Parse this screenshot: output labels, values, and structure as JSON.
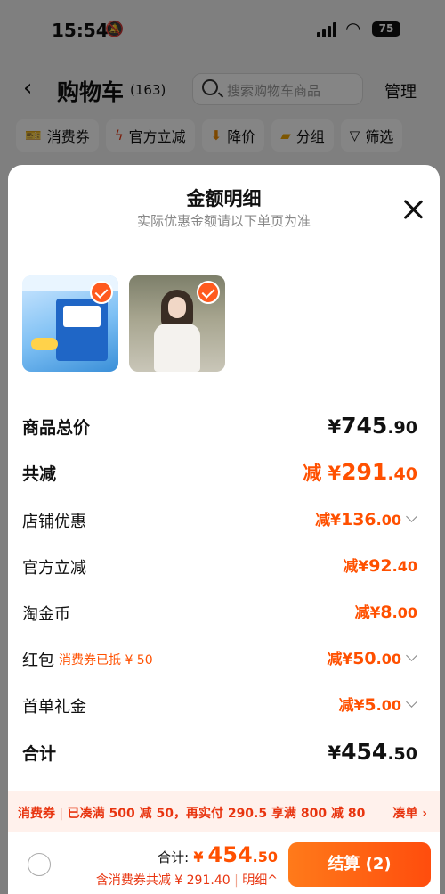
{
  "status_bar": {
    "time": "15:54",
    "battery": "75"
  },
  "cart": {
    "title": "购物车",
    "count": "(163)",
    "search_placeholder": "搜索购物车商品",
    "manage_label": "管理",
    "chips": [
      {
        "label": "消费券",
        "icon": "coupon-icon"
      },
      {
        "label": "官方立减",
        "icon": "lightning-icon"
      },
      {
        "label": "降价",
        "icon": "price-drop-icon"
      },
      {
        "label": "分组",
        "icon": "folder-icon"
      },
      {
        "label": "筛选",
        "icon": "filter-icon"
      }
    ]
  },
  "sheet": {
    "title": "金额明细",
    "subtitle": "实际优惠金额请以下单页为准",
    "rows": {
      "goods_total": {
        "label": "商品总价",
        "prefix": "¥",
        "int": "745",
        "dec": ".90"
      },
      "total_reduction": {
        "label": "共减",
        "prefix": "减 ¥",
        "int": "291",
        "dec": ".40"
      },
      "store_discount": {
        "label": "店铺优惠",
        "prefix": "减¥",
        "int": "136",
        "dec": ".00"
      },
      "official_discount": {
        "label": "官方立减",
        "prefix": "减¥",
        "int": "92",
        "dec": ".40"
      },
      "taojin_coin": {
        "label": "淘金币",
        "prefix": "减¥",
        "int": "8",
        "dec": ".00"
      },
      "red_packet": {
        "label": "红包",
        "note": "消费券已抵 ¥ 50",
        "prefix": "减¥",
        "int": "50",
        "dec": ".00"
      },
      "first_order_gift": {
        "label": "首单礼金",
        "prefix": "减¥",
        "int": "5",
        "dec": ".00"
      },
      "sum": {
        "label": "合计",
        "prefix": "¥",
        "int": "454",
        "dec": ".50"
      }
    }
  },
  "coupon_strip": {
    "tag": "消费券",
    "text": "已凑满 500 减 50，再实付 290.5 享满 800 减 80",
    "action": "凑单 ›"
  },
  "footer": {
    "total_label": "合计:",
    "total_yen": "¥",
    "total_int": "454",
    "total_dec": ".50",
    "saved_text": "含消费券共减 ¥ 291.40",
    "detail_label": "明细^",
    "checkout_label": "结算 (2)"
  },
  "colors": {
    "accent": "#ff5000",
    "checkout_start": "#ff7a1a",
    "checkout_end": "#ff4d0d",
    "strip_bg": "#fff1ec"
  }
}
